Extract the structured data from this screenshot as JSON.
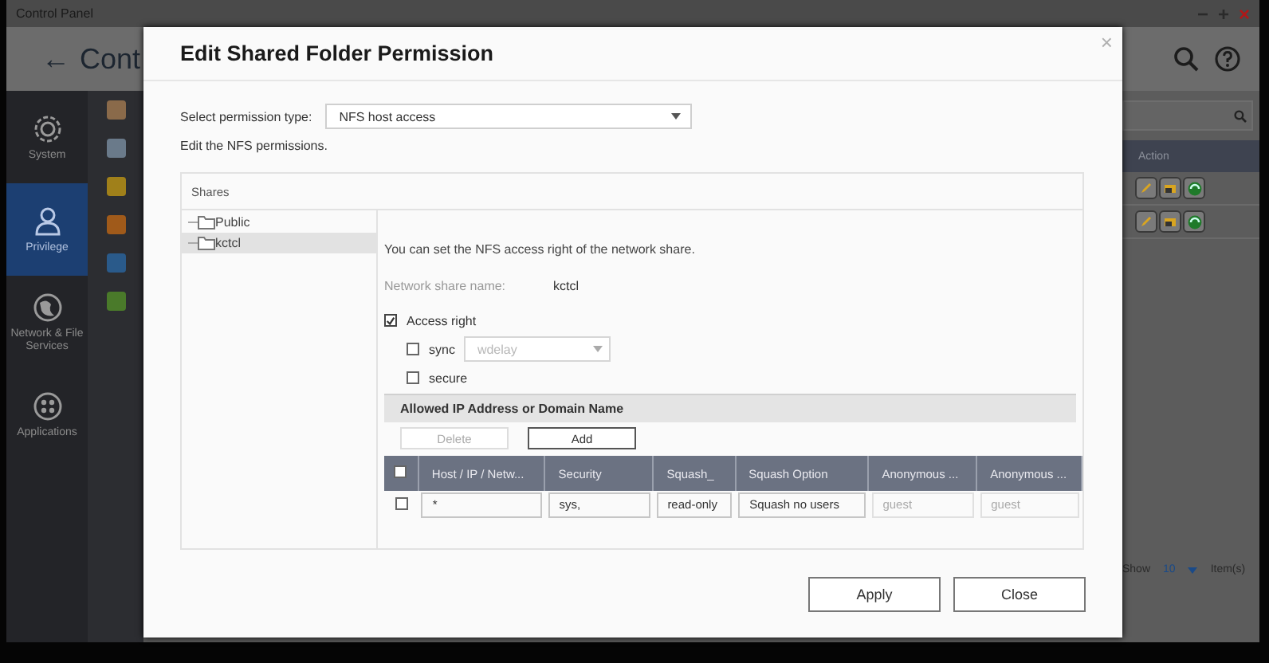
{
  "window": {
    "title": "Control Panel",
    "controls": [
      "−",
      "+",
      "×"
    ]
  },
  "header": {
    "back": "←",
    "title": "Cont"
  },
  "sidebar": {
    "items": [
      {
        "label": "System",
        "selected": false
      },
      {
        "label": "Privilege",
        "selected": true
      },
      {
        "label": "Network & File Services",
        "selected": false
      },
      {
        "label": "Applications",
        "selected": false
      }
    ]
  },
  "list": {
    "columns": [
      "Action"
    ]
  },
  "pager": {
    "label": "Show",
    "value": "10",
    "suffix": "Item(s)"
  },
  "dialog": {
    "title": "Edit Shared Folder Permission",
    "close": "×",
    "permission_type": {
      "label": "Select permission type:",
      "value": "NFS host access"
    },
    "hint": "Edit the NFS permissions.",
    "shares": {
      "header": "Shares",
      "items": [
        {
          "label": "Public",
          "selected": false
        },
        {
          "label": "kctcl",
          "selected": true
        }
      ]
    },
    "description": "You can set the NFS access right of the network share.",
    "share_name": {
      "label": "Network share name:",
      "value": "kctcl"
    },
    "options": [
      {
        "kind": "checkbox",
        "label": "Access right",
        "checked": true,
        "children": [
          {
            "kind": "select",
            "label": "sync",
            "checked": false,
            "value": "wdelay",
            "disabled": true
          },
          {
            "kind": "checkbox",
            "label": "secure",
            "checked": false
          }
        ]
      }
    ],
    "allowed": {
      "header": "Allowed IP Address or Domain Name",
      "buttons": [
        {
          "label": "Delete",
          "disabled": true
        },
        {
          "label": "Add",
          "disabled": false
        }
      ],
      "all_checked": false,
      "columns": [
        "Host / IP / Netw...",
        "Security",
        "Squash_",
        "Squash Option",
        "Anonymous ...",
        "Anonymous ..."
      ],
      "rows": [
        {
          "checked": false,
          "cells": [
            {
              "text": "*",
              "disabled": false
            },
            {
              "text": "sys,",
              "disabled": false
            },
            {
              "text": "read-only",
              "disabled": false
            },
            {
              "text": "Squash no users",
              "disabled": false
            },
            {
              "text": "guest",
              "disabled": true
            },
            {
              "text": "guest",
              "disabled": true
            }
          ]
        }
      ]
    },
    "buttons": [
      "Apply",
      "Close"
    ]
  }
}
